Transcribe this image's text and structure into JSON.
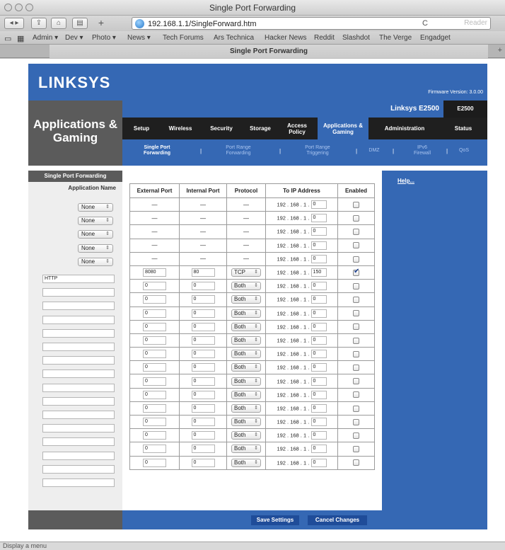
{
  "window": {
    "title": "Single Port Forwarding"
  },
  "toolbar": {
    "url": "192.168.1.1/SingleForward.htm",
    "reload": "C",
    "reader": "Reader",
    "add": "+"
  },
  "bookmarks": [
    "Admin ▾",
    "Dev ▾",
    "Photo ▾",
    "News ▾",
    "Tech Forums",
    "Ars Technica",
    "Hacker News",
    "Reddit",
    "Slashdot",
    "The Verge",
    "Engadget"
  ],
  "tab": {
    "title": "Single Port Forwarding",
    "new_tab": "+"
  },
  "status": "Display a menu",
  "page": {
    "logo": "LINKSYS",
    "firmware": "Firmware Version: 3.0.00",
    "section_title": "Applications & Gaming",
    "model_name": "Linksys E2500",
    "model_code": "E2500",
    "main_tabs": [
      "Setup",
      "Wireless",
      "Security",
      "Storage",
      "Access Policy",
      "Applications & Gaming",
      "Administration",
      "Status"
    ],
    "sub_tabs": [
      "Single Port Forwarding",
      "Port Range Forwarding",
      "Port Range Triggering",
      "DMZ",
      "IPv6 Firewall",
      "QoS"
    ],
    "left_section": "Single Port Forwarding",
    "app_name_label": "Application Name",
    "help": "Help...",
    "save": "Save Settings",
    "cancel": "Cancel Changes",
    "table_headers": [
      "External Port",
      "Internal Port",
      "Protocol",
      "To IP Address",
      "Enabled"
    ],
    "ip_prefix": "192 . 168 . 1 .",
    "dash": "—",
    "preset_rows": [
      {
        "app": "None"
      },
      {
        "app": "None"
      },
      {
        "app": "None"
      },
      {
        "app": "None"
      },
      {
        "app": "None"
      }
    ],
    "custom_rows": [
      {
        "name": "HTTP",
        "ext": "8080",
        "int": "80",
        "proto": "TCP",
        "ip": "150",
        "enabled": true
      },
      {
        "name": "",
        "ext": "0",
        "int": "0",
        "proto": "Both",
        "ip": "0",
        "enabled": false
      },
      {
        "name": "",
        "ext": "0",
        "int": "0",
        "proto": "Both",
        "ip": "0",
        "enabled": false
      },
      {
        "name": "",
        "ext": "0",
        "int": "0",
        "proto": "Both",
        "ip": "0",
        "enabled": false
      },
      {
        "name": "",
        "ext": "0",
        "int": "0",
        "proto": "Both",
        "ip": "0",
        "enabled": false
      },
      {
        "name": "",
        "ext": "0",
        "int": "0",
        "proto": "Both",
        "ip": "0",
        "enabled": false
      },
      {
        "name": "",
        "ext": "0",
        "int": "0",
        "proto": "Both",
        "ip": "0",
        "enabled": false
      },
      {
        "name": "",
        "ext": "0",
        "int": "0",
        "proto": "Both",
        "ip": "0",
        "enabled": false
      },
      {
        "name": "",
        "ext": "0",
        "int": "0",
        "proto": "Both",
        "ip": "0",
        "enabled": false
      },
      {
        "name": "",
        "ext": "0",
        "int": "0",
        "proto": "Both",
        "ip": "0",
        "enabled": false
      },
      {
        "name": "",
        "ext": "0",
        "int": "0",
        "proto": "Both",
        "ip": "0",
        "enabled": false
      },
      {
        "name": "",
        "ext": "0",
        "int": "0",
        "proto": "Both",
        "ip": "0",
        "enabled": false
      },
      {
        "name": "",
        "ext": "0",
        "int": "0",
        "proto": "Both",
        "ip": "0",
        "enabled": false
      },
      {
        "name": "",
        "ext": "0",
        "int": "0",
        "proto": "Both",
        "ip": "0",
        "enabled": false
      },
      {
        "name": "",
        "ext": "0",
        "int": "0",
        "proto": "Both",
        "ip": "0",
        "enabled": false
      }
    ]
  },
  "colors": {
    "linksys_blue": "#3568b4",
    "dark_gray": "#5b5b5b",
    "nav_black": "#1f1f1f"
  }
}
